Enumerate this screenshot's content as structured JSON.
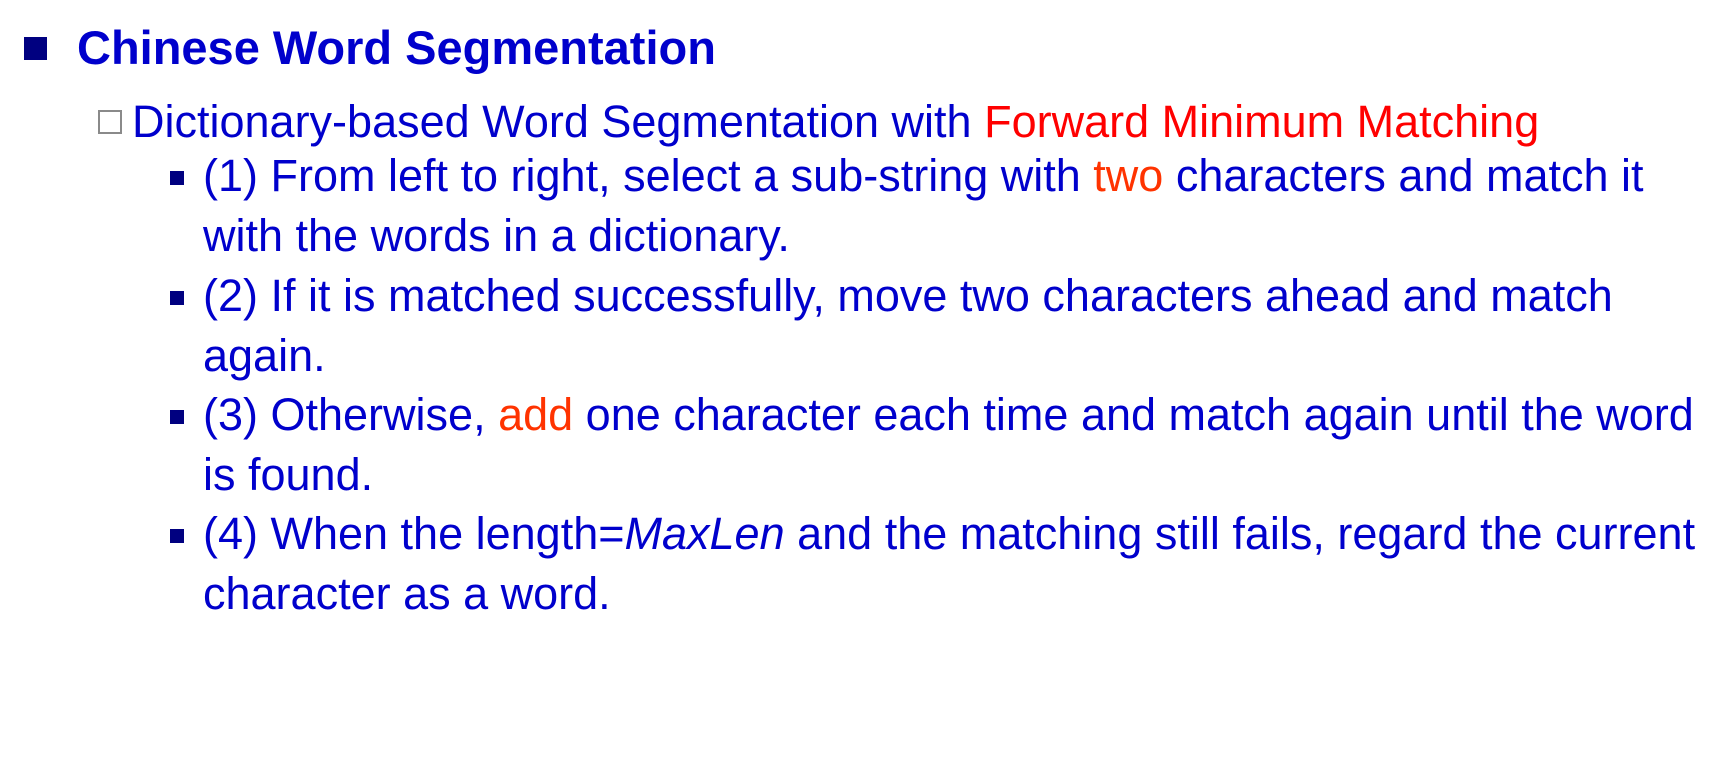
{
  "heading": "Chinese Word Segmentation",
  "subheading": {
    "prefix": "Dictionary-based Word Segmentation with ",
    "highlight": "Forward Minimum Matching"
  },
  "steps": [
    {
      "a": "(1) From left to right, select a sub-string with ",
      "hl": "two",
      "b": " characters and match it with the words in a dictionary."
    },
    {
      "text": "(2) If it is matched successfully, move two characters ahead and match again."
    },
    {
      "a": "(3) Otherwise, ",
      "hl": "add",
      "b": " one character each time and match again until the word is found."
    },
    {
      "a": "(4) When the length=",
      "italic": "MaxLen",
      "b": " and the matching still fails, regard the current character as a word."
    }
  ],
  "colors": {
    "text": "#0000cc",
    "bullet": "#000080",
    "highlight_red": "#ff0000",
    "highlight_orange": "#ff3300",
    "hollow_box": "#8a8a8a"
  }
}
